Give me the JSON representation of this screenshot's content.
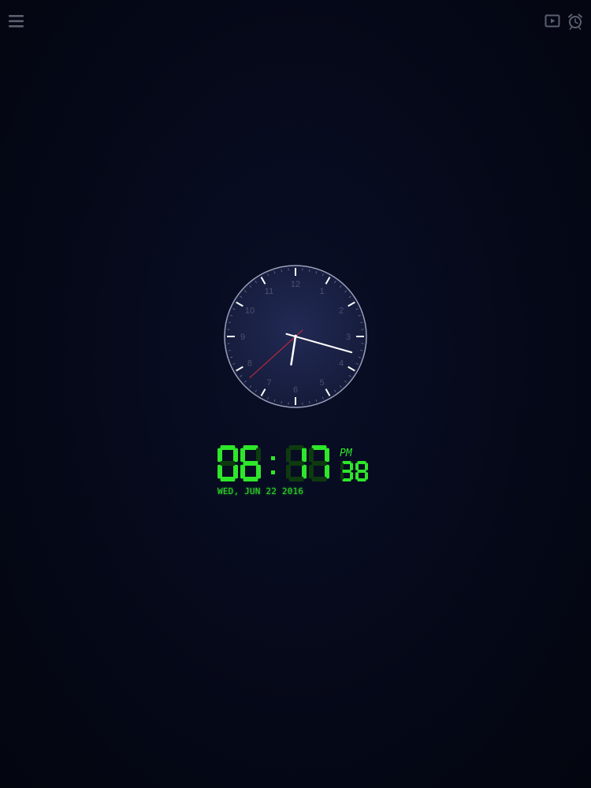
{
  "toolbar": {
    "menu_icon": "hamburger-menu-icon",
    "play_icon": "play-screen-icon",
    "alarm_icon": "alarm-clock-icon"
  },
  "analog_clock": {
    "numerals": [
      "12",
      "1",
      "2",
      "3",
      "4",
      "5",
      "6",
      "7",
      "8",
      "9",
      "10",
      "11"
    ],
    "time": {
      "hour": 6,
      "minute": 17,
      "second": 38
    },
    "colors": {
      "face": "#1a2145",
      "rim": "#9aa0b8",
      "hands": "#ffffff",
      "second_hand": "#d12a3a",
      "numerals": "#4a5070"
    }
  },
  "digital_clock": {
    "hours": "06",
    "minutes": "17",
    "seconds": "38",
    "separator": ":",
    "meridiem": "PM",
    "date": "WED, JUN 22 2016",
    "colors": {
      "lit": "#2ee62a",
      "unlit": "#0e3a10"
    }
  }
}
